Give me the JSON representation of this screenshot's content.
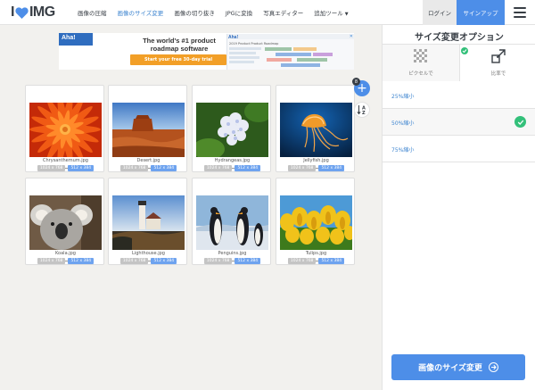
{
  "header": {
    "logo_left": "I",
    "logo_right": "IMG",
    "nav": [
      {
        "label": "画像の圧縮",
        "active": false
      },
      {
        "label": "画像のサイズ変更",
        "active": true
      },
      {
        "label": "画像の切り抜き",
        "active": false
      },
      {
        "label": "JPGに変換",
        "active": false
      },
      {
        "label": "写真エディター",
        "active": false
      },
      {
        "label": "追加ツール",
        "active": false
      }
    ],
    "login": "ログイン",
    "signup": "サインアップ"
  },
  "ad": {
    "brand": "Aha!",
    "headline": "The world's #1 product roadmap software",
    "cta": "Start your free 30-day trial",
    "shot_brand": "Aha!",
    "shot_caption": "2019 Product Product Roadmap"
  },
  "toolbar": {
    "file_count": "8",
    "add_symbol": "+",
    "sort_top": "A",
    "sort_bottom": "Z"
  },
  "files": [
    {
      "name": "Chrysanthemum.jpg",
      "original": "1024 x 768",
      "resized": "512 x 384"
    },
    {
      "name": "Desert.jpg",
      "original": "1024 x 768",
      "resized": "512 x 384"
    },
    {
      "name": "Hydrangeas.jpg",
      "original": "1024 x 768",
      "resized": "512 x 384"
    },
    {
      "name": "Jellyfish.jpg",
      "original": "1024 x 768",
      "resized": "512 x 384"
    },
    {
      "name": "Koala.jpg",
      "original": "1024 x 768",
      "resized": "512 x 384"
    },
    {
      "name": "Lighthouse.jpg",
      "original": "1024 x 768",
      "resized": "512 x 384"
    },
    {
      "name": "Penguins.jpg",
      "original": "1024 x 768",
      "resized": "512 x 384"
    },
    {
      "name": "Tulips.jpg",
      "original": "1024 x 768",
      "resized": "512 x 384"
    }
  ],
  "sidebar": {
    "title": "サイズ変更オプション",
    "tabs": [
      {
        "label": "ピクセルで",
        "selected": false
      },
      {
        "label": "比率で",
        "selected": true
      }
    ],
    "options": [
      {
        "label": "25%縮小",
        "selected": false
      },
      {
        "label": "50%縮小",
        "selected": true
      },
      {
        "label": "75%縮小",
        "selected": false
      }
    ],
    "submit": "画像のサイズ変更"
  },
  "colors": {
    "accent": "#4d8ee8",
    "link": "#3e85d0",
    "success": "#33c07a",
    "logo_heart": "#4d8ee8"
  }
}
